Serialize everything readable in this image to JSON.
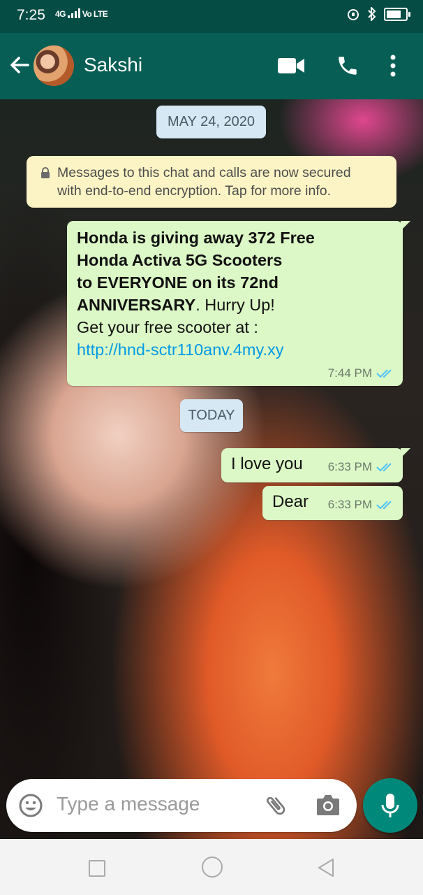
{
  "status_bar": {
    "time": "7:25",
    "network": "4G",
    "volte": "Vo LTE",
    "battery_level": 0.75
  },
  "header": {
    "contact_name": "Sakshi"
  },
  "chat": {
    "date_1": "MAY 24, 2020",
    "encryption_notice": {
      "line_1": "Messages to this chat and calls are now secured",
      "line_2": "with end-to-end encryption. Tap for more info."
    },
    "message_1": {
      "bold_1": "Honda is giving away 372 Free",
      "bold_2": "Honda Activa 5G Scooters",
      "bold_3": "to EVERYONE on its 72nd",
      "bold_4": "ANNIVERSARY",
      "text_4": ". Hurry Up!",
      "text_5": "Get your free scooter at :",
      "link": "http://hnd-sctr110anv.4my.xy",
      "time": "7:44 PM"
    },
    "date_2": "TODAY",
    "message_2": {
      "text": "I love you",
      "time": "6:33 PM"
    },
    "message_3": {
      "text": "Dear",
      "time": "6:33 PM"
    }
  },
  "composer": {
    "placeholder": "Type a message"
  },
  "colors": {
    "header": "#075e54",
    "status": "#054d44",
    "outgoing_bubble": "#dcf8c6",
    "accent": "#00897b",
    "link": "#039be5",
    "read_ticks": "#4fc3f7"
  }
}
